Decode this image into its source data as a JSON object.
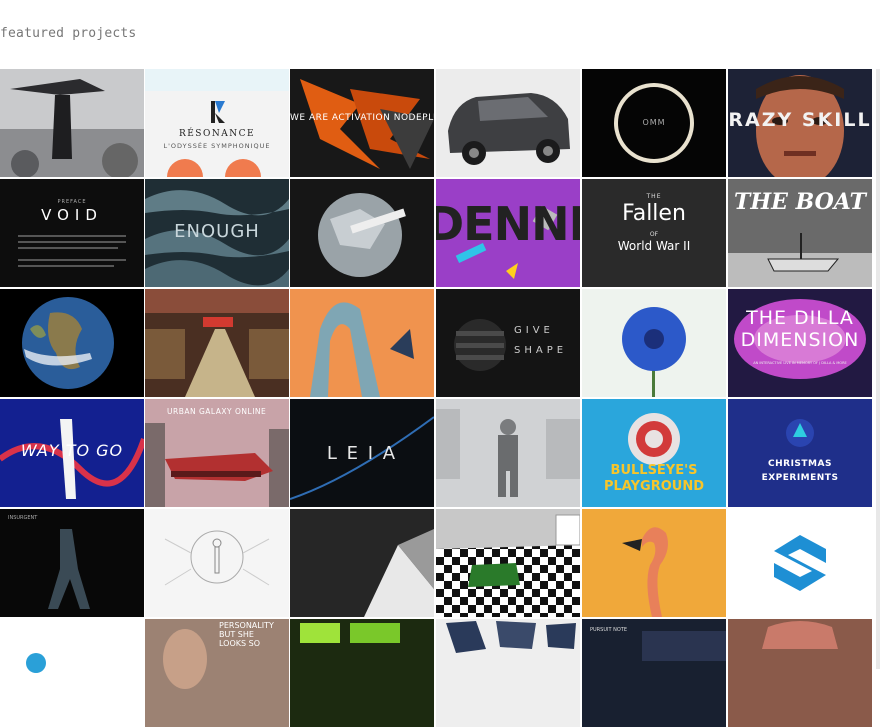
{
  "page": {
    "section_title": "featured projects"
  },
  "tiles": {
    "resonance": {
      "title": "RÉSONANCE",
      "subtitle": "L'ODYSSÉE SYMPHONIQUE"
    },
    "activation": {
      "title": "WE ARE ACTIVATION NODEPLUS"
    },
    "omm": {
      "title": "OMM"
    },
    "crazy": {
      "title": "RAZY SKILL"
    },
    "void": {
      "kicker": "PREFACE",
      "title": "VOID"
    },
    "enough": {
      "title": "ENOUGH"
    },
    "dennis": {
      "title": "DENNIS"
    },
    "fallen": {
      "the": "THE",
      "title": "Fallen",
      "of": "OF",
      "subtitle": "World War II"
    },
    "boat": {
      "title": "THE BOAT"
    },
    "give": {
      "line1": "GIVE",
      "line2": "SHAPE"
    },
    "dilla": {
      "line1": "THE DILLA",
      "line2": "DIMENSION",
      "small": "AN INTERACTIVE LIVE IN MEMORY OF J DILLA & MORE"
    },
    "way": {
      "title": "WAY TO GO"
    },
    "urban": {
      "title": "URBAN GALAXY ONLINE"
    },
    "leia": {
      "title": "L E I A"
    },
    "bullseye": {
      "line1": "BULLSEYE'S",
      "line2": "PLAYGROUND"
    },
    "christmas": {
      "line1": "CHRISTMAS",
      "line2": "EXPERIMENTS"
    },
    "insurgent": {
      "title": "INSURGENT"
    },
    "personality": {
      "line1": "PERSONALITY",
      "line2": "BUT SHE",
      "line3": "LOOKS SO"
    },
    "pursuit": {
      "title": "PURSUIT NOTE"
    }
  },
  "colors": {
    "header_text": "#777777",
    "christmas_bg": "#1f2f8a",
    "dennis_bg": "#9a3fc7",
    "orange_bg": "#f0934e",
    "flamingo_bg": "#f0a83a"
  }
}
